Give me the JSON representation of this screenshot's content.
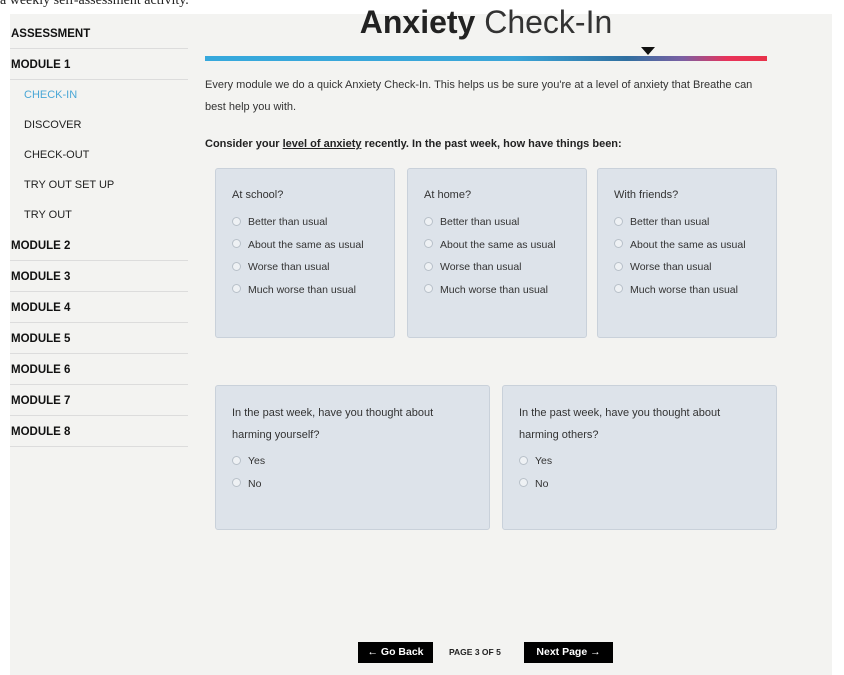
{
  "caption": "a weekly self-assessment activity.",
  "sidebar": {
    "items": [
      {
        "label": "ASSESSMENT",
        "kind": "module",
        "active": false
      },
      {
        "label": "MODULE 1",
        "kind": "module",
        "active": false
      },
      {
        "label": "CHECK-IN",
        "kind": "sub",
        "active": true
      },
      {
        "label": "DISCOVER",
        "kind": "sub",
        "active": false
      },
      {
        "label": "CHECK-OUT",
        "kind": "sub",
        "active": false
      },
      {
        "label": "TRY OUT SET UP",
        "kind": "sub",
        "active": false
      },
      {
        "label": "TRY OUT",
        "kind": "sub",
        "active": false
      },
      {
        "label": "MODULE 2",
        "kind": "module",
        "active": false
      },
      {
        "label": "MODULE 3",
        "kind": "module",
        "active": false
      },
      {
        "label": "MODULE 4",
        "kind": "module",
        "active": false
      },
      {
        "label": "MODULE 5",
        "kind": "module",
        "active": false
      },
      {
        "label": "MODULE 6",
        "kind": "module",
        "active": false
      },
      {
        "label": "MODULE 7",
        "kind": "module",
        "active": false
      },
      {
        "label": "MODULE 8",
        "kind": "module",
        "active": false
      }
    ]
  },
  "header": {
    "title_bold": "Anxiety",
    "title_light": "Check-In"
  },
  "intro": "Every module we do a quick Anxiety Check-In. This helps us be sure you're at a level of anxiety that Breathe can best help you with.",
  "question": {
    "prefix": "Consider your ",
    "link": "level of anxiety",
    "suffix": " recently. In the past week, how have things been:"
  },
  "context_cards": [
    {
      "title": "At school?",
      "options": [
        "Better than usual",
        "About the same as usual",
        "Worse than usual",
        "Much worse than usual"
      ]
    },
    {
      "title": "At home?",
      "options": [
        "Better than usual",
        "About the same as usual",
        "Worse than usual",
        "Much worse than usual"
      ]
    },
    {
      "title": "With friends?",
      "options": [
        "Better than usual",
        "About the same as usual",
        "Worse than usual",
        "Much worse than usual"
      ]
    }
  ],
  "harm_cards": [
    {
      "question": "In the past week, have you thought about harming yourself?",
      "options": [
        "Yes",
        "No"
      ]
    },
    {
      "question": "In the past week, have you thought about harming others?",
      "options": [
        "Yes",
        "No"
      ]
    }
  ],
  "footer": {
    "back_label": "← Go Back",
    "page_indicator": "PAGE 3 OF 5",
    "next_label": "Next Page →"
  },
  "colors": {
    "active_nav": "#4aa7d6",
    "card_bg": "#dde3ea",
    "button_bg": "#000000",
    "rule_start": "#36a8dc",
    "rule_end": "#e8324a"
  }
}
